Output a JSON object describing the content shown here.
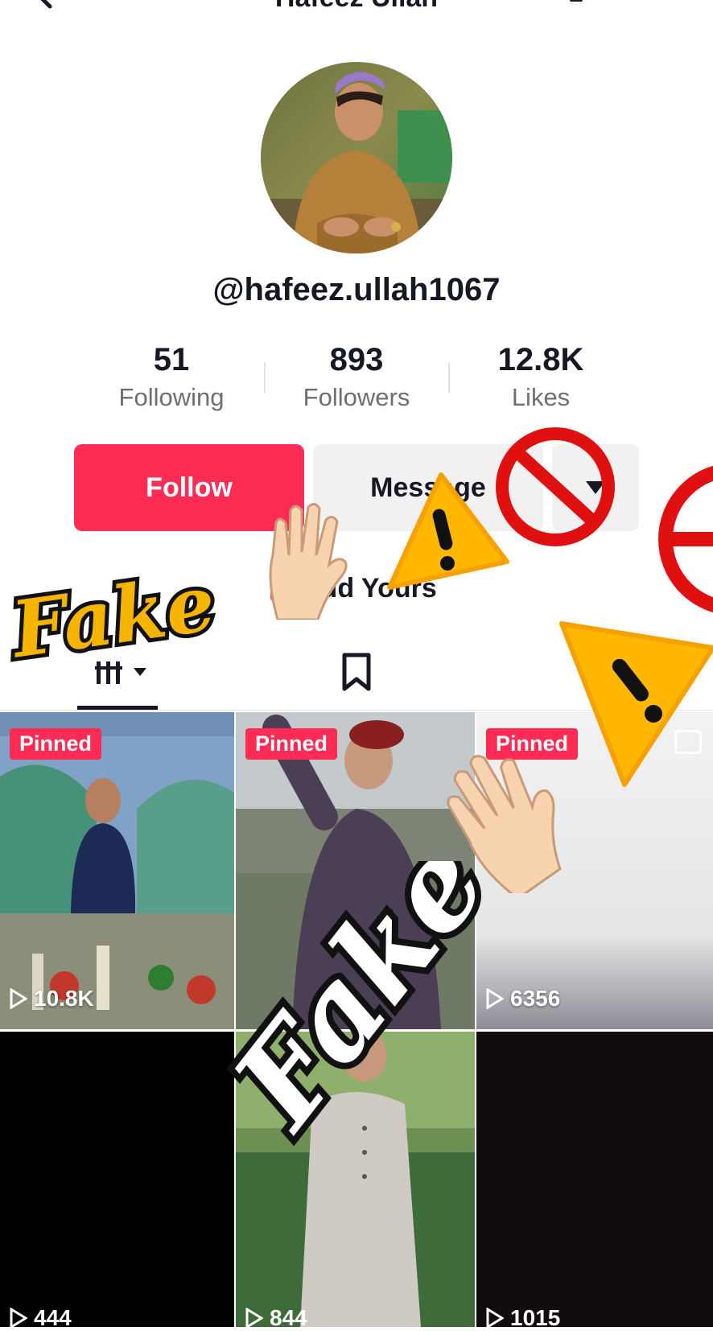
{
  "header": {
    "title": "Hafeez Ullah",
    "back_icon": "chevron-left-icon",
    "bell_icon": "bell-icon",
    "share_icon": "share-icon"
  },
  "profile": {
    "username": "@hafeez.ullah1067",
    "stats": [
      {
        "value": "51",
        "label": "Following"
      },
      {
        "value": "893",
        "label": "Followers"
      },
      {
        "value": "12.8K",
        "label": "Likes"
      }
    ]
  },
  "actions": {
    "follow_label": "Follow",
    "message_label": "Message",
    "more_icon": "caret-down-icon"
  },
  "add_yours_label": "Add Yours",
  "tabs": {
    "videos_icon": "videos-grid-icon",
    "saved_icon": "bookmark-icon"
  },
  "videos": [
    {
      "pinned": "Pinned",
      "views": "10.8K"
    },
    {
      "pinned": "Pinned",
      "views": ""
    },
    {
      "pinned": "Pinned",
      "views": "6356"
    },
    {
      "pinned": "",
      "views": "444"
    },
    {
      "pinned": "",
      "views": "844"
    },
    {
      "pinned": "",
      "views": "1015"
    }
  ],
  "stickers": {
    "fake_1": "Fake",
    "fake_2": "Fake"
  },
  "colors": {
    "accent": "#fe2c55",
    "secondary_btn": "#f1f1f2",
    "text": "#161823",
    "muted": "#6e6e73"
  }
}
